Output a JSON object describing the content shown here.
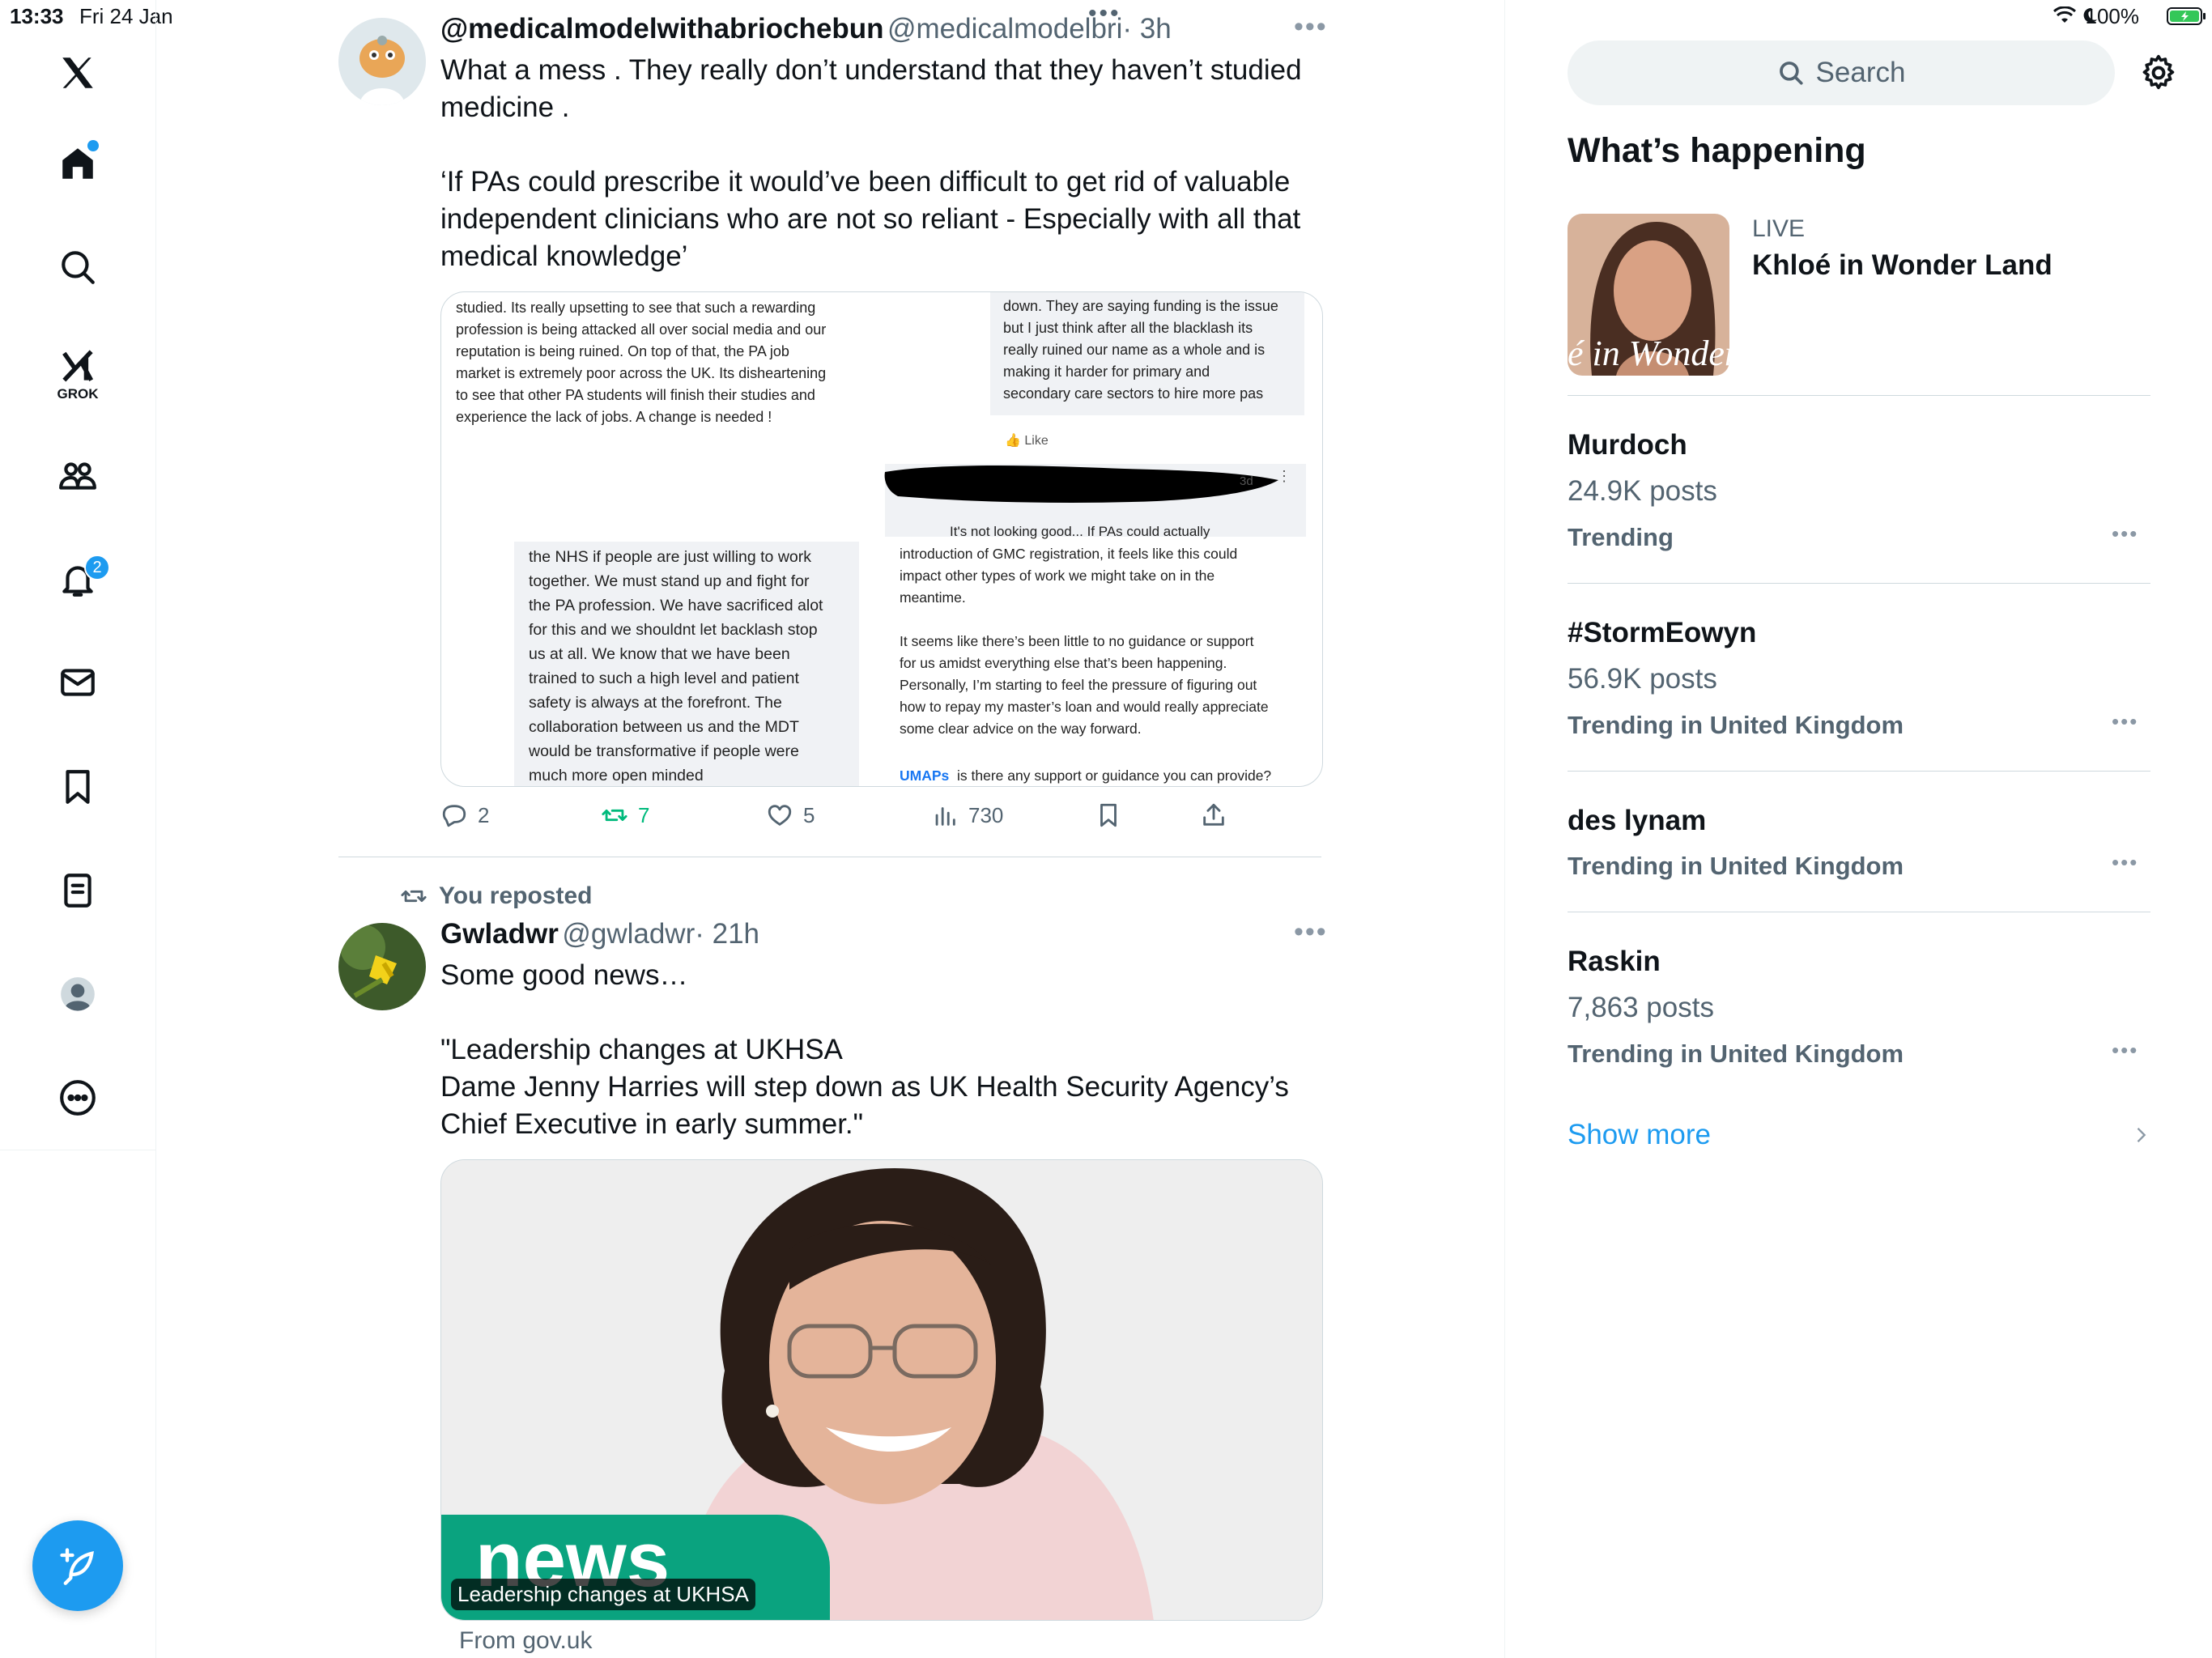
{
  "status_bar": {
    "time": "13:33",
    "date": "Fri 24 Jan",
    "battery": "100%"
  },
  "nav": {
    "grok_label": "GROK",
    "notifications_badge": "2"
  },
  "tweet1": {
    "name": "@medicalmodelwithabriochebun",
    "handle": "@medicalmodelbri",
    "time": "· 3h",
    "text": "What a mess . They really don’t understand that they haven’t studied medicine .\n\n‘If PAs could prescribe it would’ve been difficult to get rid of valuable independent clinicians who are not so reliant - Especially with all that medical knowledge’",
    "shot": {
      "left_top": "studied. Its really upsetting to see that such a rewarding\nprofession is being attacked all over social media and our\nreputation is being ruined. On top of that, the PA job\nmarket is extremely poor across the UK. Its disheartening\nto see that other PA students will finish their studies and\nexperience the lack of jobs. A change is needed !",
      "right_top": "down. They are saying funding is the issue\nbut I just think after all the blacklash its\nreally ruined our name as a whole and is\nmaking it harder for primary and\nsecondary care sectors to hire more pas",
      "like": "Like",
      "age": "3d",
      "left_bottom": "the NHS if people are just willing to work\ntogether. We must stand up and fight for\nthe PA profession. We have sacrificed alot\nfor this and we shouldnt let backlash stop\nus at all. We know that we have been\ntrained to such a high level and patient\nsafety is always at the forefront. The\ncollaboration between us and the MDT\nwould be transformative if people were\nmuch more open minded",
      "right_bottom_1": "It's not looking good... If PAs could actually",
      "right_bottom_2": "introduction of GMC registration, it feels like this could\nimpact other types of work we might take on in the\nmeantime.\n\nIt seems like there’s been little to no guidance or support\nfor us amidst everything else that’s been happening.\nPersonally, I’m starting to feel the pressure of figuring out\nhow to repay my master’s loan and would really appreciate\nsome clear advice on the way forward.",
      "umaps": "UMAPs",
      "umaps_q": "is there any support or guidance you can provide?"
    },
    "replies": "2",
    "reposts": "7",
    "likes": "5",
    "views": "730"
  },
  "tweet2": {
    "repost_label": "You reposted",
    "name": "Gwladwr",
    "handle": "@gwladwr",
    "time": "· 21h",
    "text": "Some good news…\n\n\"Leadership changes at UKHSA\nDame Jenny Harries will step down as UK Health Security Agency’s Chief Executive in early summer.\"",
    "card_word": "news",
    "card_caption": "Leadership changes at UKHSA",
    "source": "From gov.uk"
  },
  "sidebar": {
    "search_placeholder": "Search",
    "section_title": "What’s happening",
    "live_label": "LIVE",
    "live_title": "Khloé in Wonder Land",
    "live_thumb_text": "é in Wonder L",
    "trends": [
      {
        "title": "Murdoch",
        "posts": "24.9K posts",
        "meta": "Trending"
      },
      {
        "title": "#StormEowyn",
        "posts": "56.9K posts",
        "meta": "Trending in United Kingdom"
      },
      {
        "title": "des lynam",
        "posts": "",
        "meta": "Trending in United Kingdom"
      },
      {
        "title": "Raskin",
        "posts": "7,863 posts",
        "meta": "Trending in United Kingdom"
      }
    ],
    "show_more": "Show more"
  },
  "colors": {
    "accent": "#1d9bf0",
    "repost_green": "#00ba7c",
    "news_green": "#0aa37f"
  }
}
